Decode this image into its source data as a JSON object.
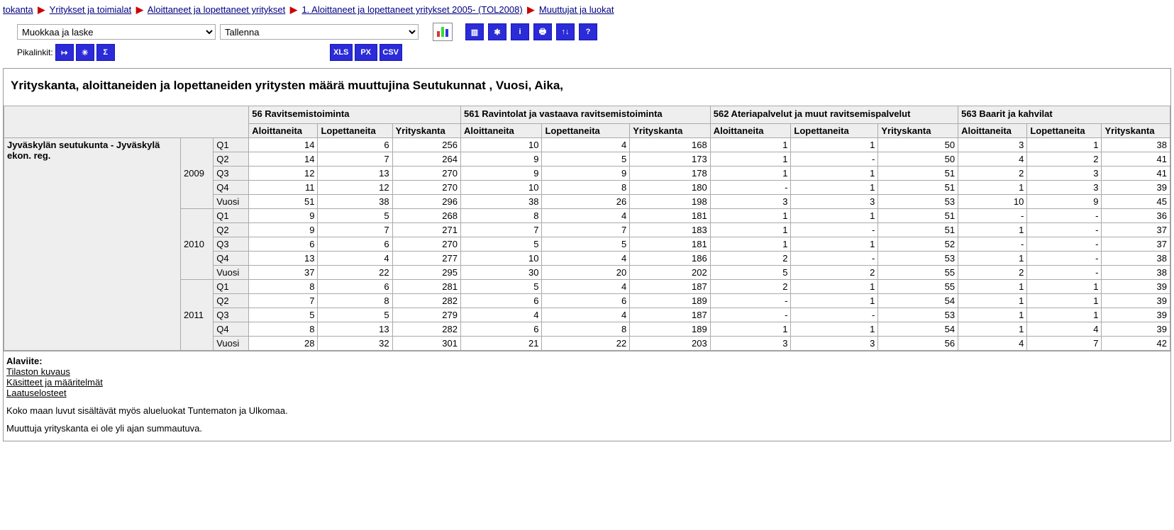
{
  "breadcrumbs": {
    "items": [
      "tokanta",
      "Yritykset ja toimialat",
      "Aloittaneet ja lopettaneet yritykset",
      "1. Aloittaneet ja lopettaneet yritykset 2005- (TOL2008)",
      "Muuttujat ja luokat"
    ]
  },
  "toolbar": {
    "edit_calc": "Muokkaa ja laske",
    "save": "Tallenna",
    "xls": "XLS",
    "px": "PX",
    "csv": "CSV"
  },
  "quicklinks": {
    "label": "Pikalinkit:"
  },
  "table": {
    "title": "Yrityskanta, aloittaneiden ja lopettaneiden yritysten määrä muuttujina Seutukunnat , Vuosi, Aika,",
    "col_groups": [
      "56 Ravitsemistoiminta",
      "561 Ravintolat ja vastaava ravitsemistoiminta",
      "562 Ateriapalvelut ja muut ravitsemispalvelut",
      "563 Baarit ja kahvilat"
    ],
    "sub_cols": [
      "Aloittaneita",
      "Lopettaneita",
      "Yrityskanta"
    ],
    "row_label": "Jyväskylän seutukunta - Jyväskylä ekon. reg.",
    "years": [
      "2009",
      "2010",
      "2011"
    ],
    "periods": [
      "Q1",
      "Q2",
      "Q3",
      "Q4",
      "Vuosi"
    ],
    "values": {
      "2009": {
        "Q1": [
          "14",
          "6",
          "256",
          "10",
          "4",
          "168",
          "1",
          "1",
          "50",
          "3",
          "1",
          "38"
        ],
        "Q2": [
          "14",
          "7",
          "264",
          "9",
          "5",
          "173",
          "1",
          "-",
          "50",
          "4",
          "2",
          "41"
        ],
        "Q3": [
          "12",
          "13",
          "270",
          "9",
          "9",
          "178",
          "1",
          "1",
          "51",
          "2",
          "3",
          "41"
        ],
        "Q4": [
          "11",
          "12",
          "270",
          "10",
          "8",
          "180",
          "-",
          "1",
          "51",
          "1",
          "3",
          "39"
        ],
        "Vuosi": [
          "51",
          "38",
          "296",
          "38",
          "26",
          "198",
          "3",
          "3",
          "53",
          "10",
          "9",
          "45"
        ]
      },
      "2010": {
        "Q1": [
          "9",
          "5",
          "268",
          "8",
          "4",
          "181",
          "1",
          "1",
          "51",
          "-",
          "-",
          "36"
        ],
        "Q2": [
          "9",
          "7",
          "271",
          "7",
          "7",
          "183",
          "1",
          "-",
          "51",
          "1",
          "-",
          "37"
        ],
        "Q3": [
          "6",
          "6",
          "270",
          "5",
          "5",
          "181",
          "1",
          "1",
          "52",
          "-",
          "-",
          "37"
        ],
        "Q4": [
          "13",
          "4",
          "277",
          "10",
          "4",
          "186",
          "2",
          "-",
          "53",
          "1",
          "-",
          "38"
        ],
        "Vuosi": [
          "37",
          "22",
          "295",
          "30",
          "20",
          "202",
          "5",
          "2",
          "55",
          "2",
          "-",
          "38"
        ]
      },
      "2011": {
        "Q1": [
          "8",
          "6",
          "281",
          "5",
          "4",
          "187",
          "2",
          "1",
          "55",
          "1",
          "1",
          "39"
        ],
        "Q2": [
          "7",
          "8",
          "282",
          "6",
          "6",
          "189",
          "-",
          "1",
          "54",
          "1",
          "1",
          "39"
        ],
        "Q3": [
          "5",
          "5",
          "279",
          "4",
          "4",
          "187",
          "-",
          "-",
          "53",
          "1",
          "1",
          "39"
        ],
        "Q4": [
          "8",
          "13",
          "282",
          "6",
          "8",
          "189",
          "1",
          "1",
          "54",
          "1",
          "4",
          "39"
        ],
        "Vuosi": [
          "28",
          "32",
          "301",
          "21",
          "22",
          "203",
          "3",
          "3",
          "56",
          "4",
          "7",
          "42"
        ]
      }
    }
  },
  "footnotes": {
    "heading": "Alaviite:",
    "links": [
      "Tilaston kuvaus",
      "Käsitteet ja määritelmät",
      "Laatuselosteet"
    ],
    "notes": [
      "Koko maan luvut sisältävät myös alueluokat Tuntematon ja Ulkomaa.",
      "Muuttuja yrityskanta ei ole yli ajan summautuva."
    ]
  }
}
